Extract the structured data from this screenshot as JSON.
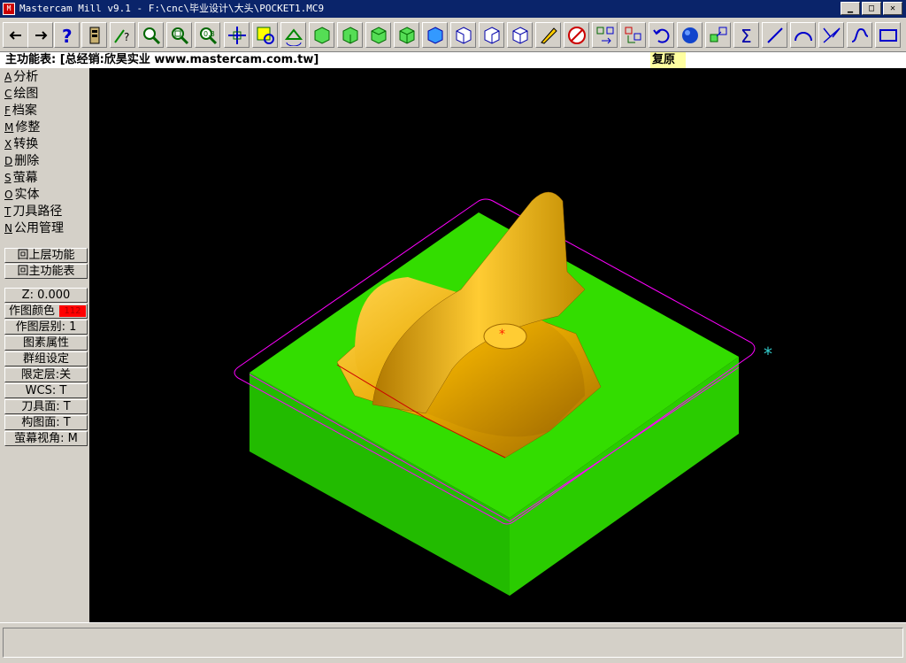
{
  "window": {
    "title": "Mastercam Mill v9.1 - F:\\cnc\\毕业设计\\大头\\POCKET1.MC9",
    "icon_text": "M",
    "controls": [
      "minimize-icon",
      "maximize-icon",
      "close-icon"
    ]
  },
  "toolbar": {
    "buttons": [
      "back-arrow",
      "forward-arrow",
      "help",
      "memory",
      "analyze-query",
      "zoom-window",
      "zoom-unzoom",
      "zoom-fit",
      "pan",
      "select-window",
      "rotate",
      "view-iso-1",
      "view-iso-2",
      "view-iso-3",
      "view-iso-4",
      "view-top",
      "view-front",
      "view-side",
      "view-iso",
      "eraser",
      "no-draw",
      "move",
      "translate",
      "undo",
      "sphere-shade",
      "layer",
      "sum",
      "line",
      "arc",
      "fillet",
      "spline",
      "rectangle"
    ]
  },
  "menubar": {
    "title": "主功能表: [总经销:欣昊实业 www.mastercam.com.tw]",
    "restore_label": "复原"
  },
  "main_menu": [
    {
      "key": "A",
      "label": "分析"
    },
    {
      "key": "C",
      "label": "绘图"
    },
    {
      "key": "F",
      "label": "档案"
    },
    {
      "key": "M",
      "label": "修整"
    },
    {
      "key": "X",
      "label": "转换"
    },
    {
      "key": "D",
      "label": "删除"
    },
    {
      "key": "S",
      "label": "萤幕"
    },
    {
      "key": "O",
      "label": "实体"
    },
    {
      "key": "T",
      "label": "刀具路径"
    },
    {
      "key": "N",
      "label": "公用管理"
    }
  ],
  "nav_buttons": {
    "back": "回上层功能",
    "main": "回主功能表"
  },
  "status_panel": {
    "z": "Z:  0.000",
    "color_label": "作图颜色",
    "color_value": "112",
    "level": "作图层别: 1",
    "attributes": "图素属性",
    "group": "群组设定",
    "mask": "限定层:关",
    "wcs": "WCS:  T",
    "tplane": "刀具面: T",
    "cplane": "构图面: T",
    "gview": "萤幕视角: M"
  },
  "prompt": {
    "text": ""
  },
  "colors": {
    "green_block": "#22cc00",
    "part_gold": "#e6a800",
    "boundary_magenta": "#ff00ff",
    "cyan_marker": "#33cccc"
  }
}
